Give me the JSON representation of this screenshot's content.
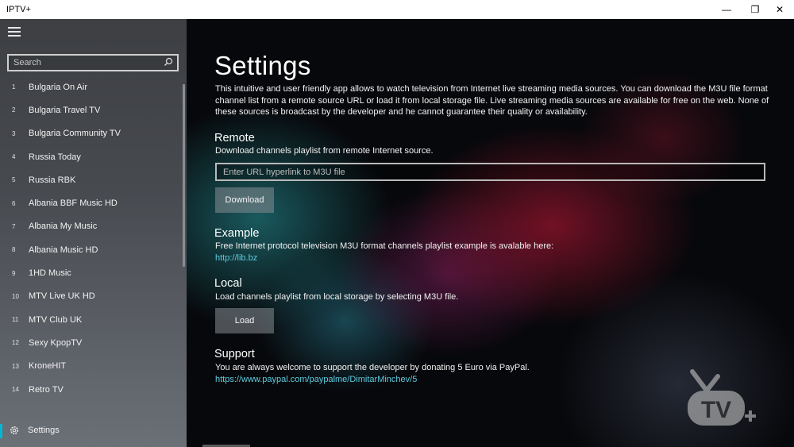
{
  "window": {
    "title": "IPTV+",
    "controls": {
      "minimize": "—",
      "maximize": "❐",
      "close": "✕"
    }
  },
  "sidebar": {
    "search": {
      "placeholder": "Search",
      "value": ""
    },
    "channels": [
      {
        "num": "1",
        "name": "Bulgaria On Air"
      },
      {
        "num": "2",
        "name": "Bulgaria Travel TV"
      },
      {
        "num": "3",
        "name": "Bulgaria Community TV"
      },
      {
        "num": "4",
        "name": "Russia Today"
      },
      {
        "num": "5",
        "name": "Russia RBK"
      },
      {
        "num": "6",
        "name": "Albania BBF Music HD"
      },
      {
        "num": "7",
        "name": "Albania My Music"
      },
      {
        "num": "8",
        "name": "Albania Music HD"
      },
      {
        "num": "9",
        "name": "1HD Music"
      },
      {
        "num": "10",
        "name": "MTV Live UK HD"
      },
      {
        "num": "11",
        "name": "MTV Club UK"
      },
      {
        "num": "12",
        "name": "Sexy KpopTV"
      },
      {
        "num": "13",
        "name": "KroneHIT"
      },
      {
        "num": "14",
        "name": "Retro TV"
      }
    ],
    "settings_label": "Settings",
    "accent_color": "#00b7d4"
  },
  "main": {
    "title": "Settings",
    "intro": "This intuitive and user friendly app allows to watch television from Internet live streaming media sources. You can download the M3U file format channel list from a remote source URL or load it from local storage file. Live streaming media sources are available for free on the web. None of these sources is broadcast by the developer and he cannot guarantee their quality or availability.",
    "remote": {
      "heading": "Remote",
      "text": "Download channels playlist from remote Internet source.",
      "url_placeholder": "Enter URL hyperlink to M3U file",
      "url_value": "",
      "button": "Download"
    },
    "example": {
      "heading": "Example",
      "text": "Free Internet protocol television M3U format channels playlist example is avalable here:",
      "link": "http://lib.bz"
    },
    "local": {
      "heading": "Local",
      "text": "Load channels playlist from local storage by selecting M3U file.",
      "button": "Load"
    },
    "support": {
      "heading": "Support",
      "text": "You are always welcome to support the developer by donating 5 Euro via PayPal.",
      "link": "https://www.paypal.com/paypalme/DimitarMinchev/5"
    },
    "link_color": "#5ecbe0",
    "logo_icon": "tv-plus-logo"
  }
}
